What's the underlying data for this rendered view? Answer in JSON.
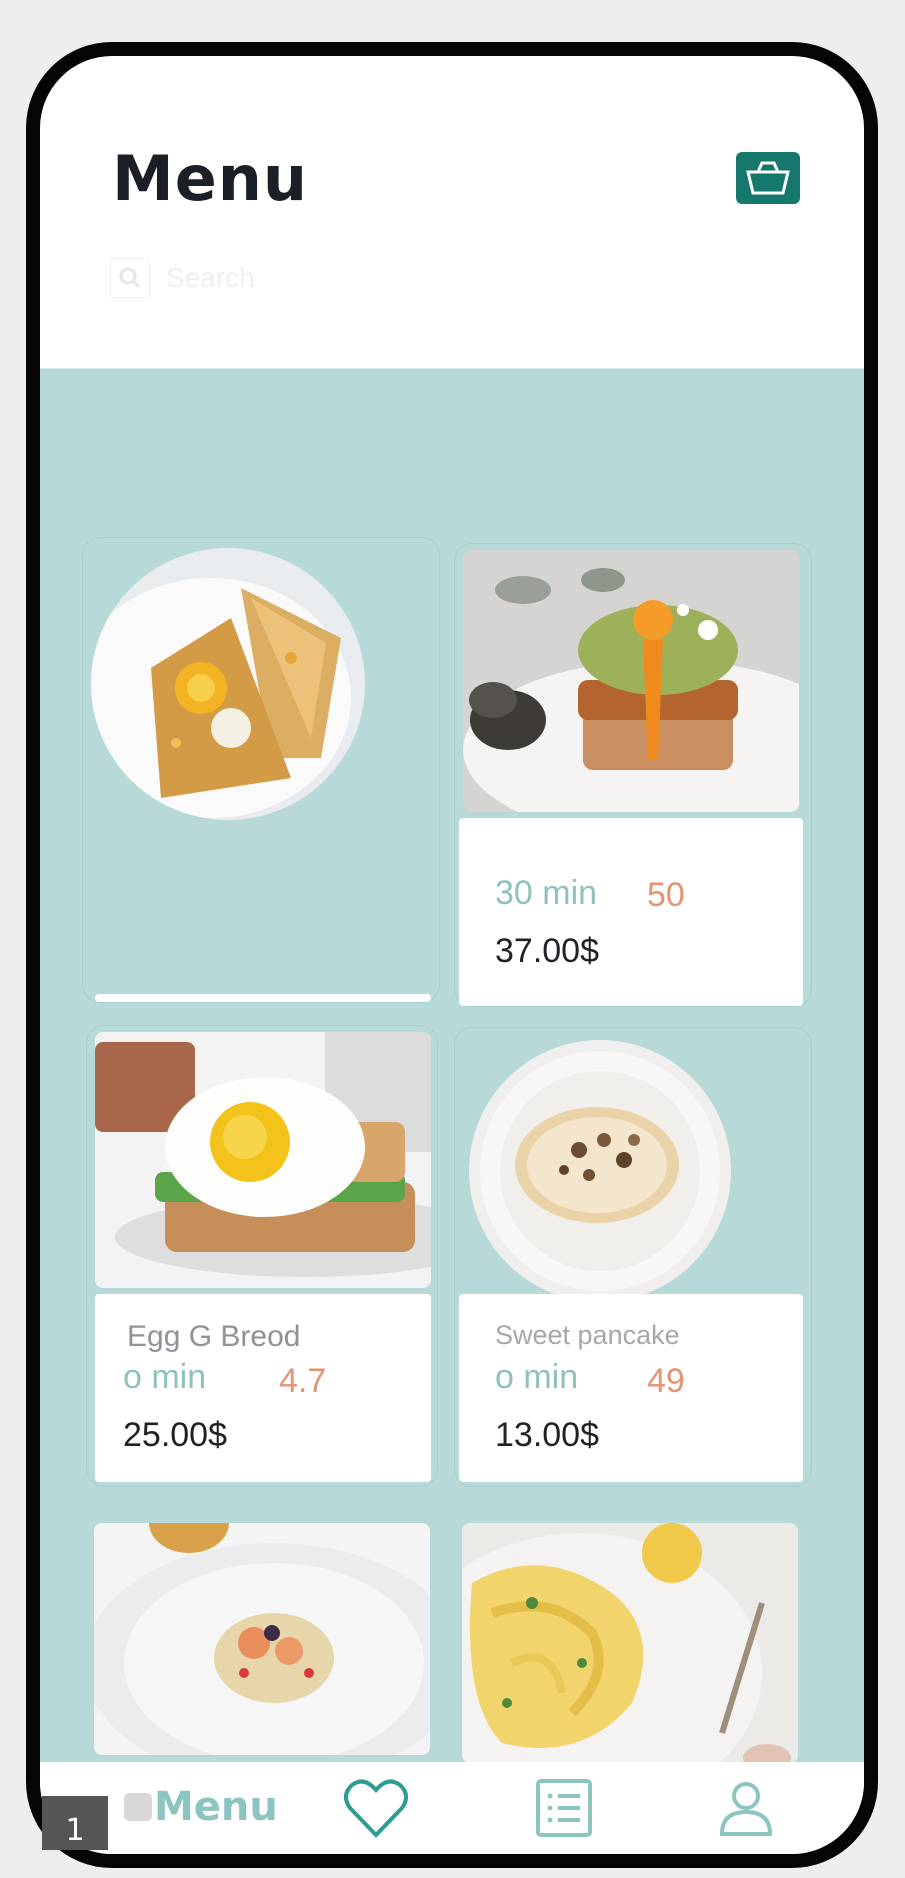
{
  "header": {
    "title": "Menu"
  },
  "search": {
    "placeholder": "Search"
  },
  "products": [
    {
      "name": "",
      "time": "",
      "rating": "",
      "price": ""
    },
    {
      "name": "",
      "time": "30 min",
      "rating": "50",
      "price": "37.00$"
    },
    {
      "name": "Egg G Breod",
      "time": "o min",
      "rating": "4.7",
      "price": "25.00$"
    },
    {
      "name": "Sweet pancake",
      "time": "o min",
      "rating": "49",
      "price": "13.00$"
    },
    {
      "name": "",
      "time": "",
      "rating": "",
      "price": ""
    },
    {
      "name": "",
      "time": "",
      "rating": "",
      "price": ""
    }
  ],
  "tabbar": {
    "menu_label": "Menu"
  },
  "page_badge": "1",
  "colors": {
    "accent": "#16786d",
    "content_bg": "#b7d9d7",
    "time": "#8fc2bd",
    "rating": "#e69273"
  }
}
